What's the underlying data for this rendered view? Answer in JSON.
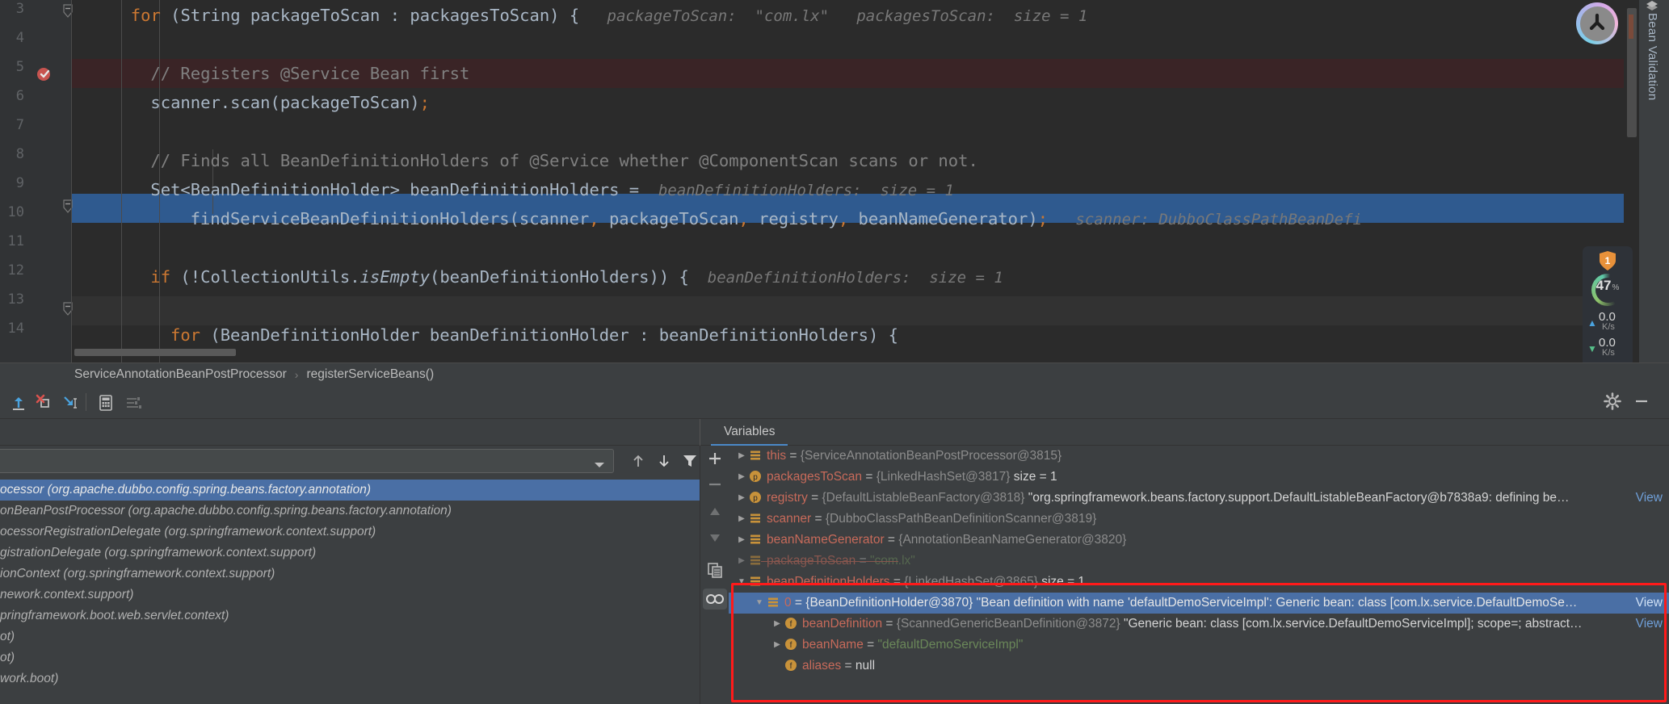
{
  "editor": {
    "lines": [
      {
        "no": "3",
        "indent": 6,
        "segs": [
          {
            "t": "for ",
            "c": "kw"
          },
          {
            "t": "(String packageToScan : packagesToScan) {",
            "c": "pl"
          },
          {
            "t": "   packageToScan:  \"com.lx\"   packagesToScan:  size = 1",
            "c": "hint"
          }
        ]
      },
      {
        "no": "4",
        "indent": 0,
        "segs": []
      },
      {
        "no": "5",
        "indent": 8,
        "segs": [
          {
            "t": "// Registers @Service Bean first",
            "c": "cm"
          }
        ]
      },
      {
        "no": "6",
        "indent": 8,
        "segs": [
          {
            "t": "scanner.scan(packageToScan)",
            "c": "pl"
          },
          {
            "t": ";",
            "c": "sep"
          }
        ]
      },
      {
        "no": "7",
        "indent": 0,
        "segs": []
      },
      {
        "no": "8",
        "indent": 8,
        "segs": [
          {
            "t": "// Finds all BeanDefinitionHolders of @Service whether @ComponentScan scans or not.",
            "c": "cm"
          }
        ]
      },
      {
        "no": "9",
        "indent": 8,
        "segs": [
          {
            "t": "Set<BeanDefinitionHolder> beanDefinitionHolders = ",
            "c": "pl"
          },
          {
            "t": " beanDefinitionHolders:  size = 1",
            "c": "hint"
          }
        ]
      },
      {
        "no": "10",
        "indent": 12,
        "segs": [
          {
            "t": "findServiceBeanDefinitionHolders(scanner",
            "c": "pl"
          },
          {
            "t": ", ",
            "c": "sep"
          },
          {
            "t": "packageToScan",
            "c": "pl"
          },
          {
            "t": ", ",
            "c": "sep"
          },
          {
            "t": "registry",
            "c": "pl"
          },
          {
            "t": ", ",
            "c": "sep"
          },
          {
            "t": "beanNameGenerator)",
            "c": "pl"
          },
          {
            "t": ";",
            "c": "sep"
          },
          {
            "t": "   scanner: DubboClassPathBeanDefi",
            "c": "hint"
          }
        ]
      },
      {
        "no": "11",
        "indent": 0,
        "segs": []
      },
      {
        "no": "12",
        "indent": 8,
        "segs": [
          {
            "t": "if ",
            "c": "kw"
          },
          {
            "t": "(!CollectionUtils.",
            "c": "pl"
          },
          {
            "t": "isEmpty",
            "c": "mi"
          },
          {
            "t": "(beanDefinitionHolders)) {",
            "c": "pl"
          },
          {
            "t": "  beanDefinitionHolders:  size = 1",
            "c": "hint"
          }
        ]
      },
      {
        "no": "13",
        "indent": 0,
        "segs": []
      },
      {
        "no": "14",
        "indent": 10,
        "segs": [
          {
            "t": "for ",
            "c": "kw"
          },
          {
            "t": "(BeanDefinitionHolder beanDefinitionHolder : beanDefinitionHolders) {",
            "c": "pl"
          }
        ]
      }
    ],
    "breadcrumb": {
      "class_name": "ServiceAnnotationBeanPostProcessor",
      "separator": "›",
      "method_name": "registerServiceBeans()"
    },
    "right_tab_label": "Bean Validation",
    "perf": {
      "inspection_count": "1",
      "memory_percent": "47",
      "percent_symbol": "%",
      "upload_value": "0.0",
      "upload_unit": "K/s",
      "download_value": "0.0",
      "download_unit": "K/s"
    }
  },
  "debug_toolbar": {
    "buttons": [
      {
        "name": "step-out-icon",
        "tooltip": "Step Out"
      },
      {
        "name": "force-step-into-icon",
        "tooltip": "Force Step Into"
      },
      {
        "name": "run-to-cursor-icon",
        "tooltip": "Run to Cursor"
      },
      {
        "name": "evaluate-expression-icon",
        "tooltip": "Evaluate Expression"
      },
      {
        "name": "settings-threads-icon",
        "tooltip": "Settings"
      }
    ],
    "gear_label": "Settings",
    "minimize_label": "Hide",
    "layout_label": "Layout Settings"
  },
  "variables_tab": {
    "label": "Variables"
  },
  "frames": {
    "search_value": "",
    "search_placeholder": "",
    "rows": [
      {
        "text": "ocessor (org.apache.dubbo.config.spring.beans.factory.annotation)",
        "selected": true
      },
      {
        "text": "onBeanPostProcessor (org.apache.dubbo.config.spring.beans.factory.annotation)",
        "selected": false
      },
      {
        "text": "ocessorRegistrationDelegate (org.springframework.context.support)",
        "selected": false
      },
      {
        "text": "gistrationDelegate (org.springframework.context.support)",
        "selected": false
      },
      {
        "text": "ionContext (org.springframework.context.support)",
        "selected": false
      },
      {
        "text": "nework.context.support)",
        "selected": false
      },
      {
        "text": "pringframework.boot.web.servlet.context)",
        "selected": false
      },
      {
        "text": "ot)",
        "selected": false
      },
      {
        "text": "ot)",
        "selected": false
      },
      {
        "text": "work.boot)",
        "selected": false
      }
    ]
  },
  "variables": {
    "side_buttons": [
      {
        "name": "add-watch-icon",
        "glyph": "+"
      },
      {
        "name": "remove-watch-icon",
        "glyph": "−"
      },
      {
        "name": "move-up-icon",
        "glyph": "▲"
      },
      {
        "name": "move-down-icon",
        "glyph": "▼"
      },
      {
        "name": "copy-value-icon",
        "glyph": ""
      },
      {
        "name": "watches-icon",
        "glyph": ""
      }
    ],
    "rows": [
      {
        "indent": 0,
        "arrow": "collapsed",
        "icon": "field",
        "name": "this",
        "eq": " = ",
        "type": "{ServiceAnnotationBeanPostProcessor@3815}",
        "value": "",
        "size": "",
        "view": "",
        "selected": false
      },
      {
        "indent": 0,
        "arrow": "collapsed",
        "icon": "param",
        "name": "packagesToScan",
        "eq": " = ",
        "type": "{LinkedHashSet@3817}",
        "value": "",
        "size": "  size = 1",
        "view": "",
        "selected": false
      },
      {
        "indent": 0,
        "arrow": "collapsed",
        "icon": "param",
        "name": "registry",
        "eq": " = ",
        "type": "{DefaultListableBeanFactory@3818}",
        "value": " \"org.springframework.beans.factory.support.DefaultListableBeanFactory@b7838a9: defining be…",
        "size": "",
        "view": "View",
        "selected": false
      },
      {
        "indent": 0,
        "arrow": "collapsed",
        "icon": "field",
        "name": "scanner",
        "eq": " = ",
        "type": "{DubboClassPathBeanDefinitionScanner@3819}",
        "value": "",
        "size": "",
        "view": "",
        "selected": false
      },
      {
        "indent": 0,
        "arrow": "collapsed",
        "icon": "field",
        "name": "beanNameGenerator",
        "eq": " = ",
        "type": "{AnnotationBeanNameGenerator@3820}",
        "value": "",
        "size": "",
        "view": "",
        "selected": false
      },
      {
        "indent": 0,
        "arrow": "collapsed",
        "icon": "field",
        "name": "packageToScan",
        "eq": " = ",
        "type": "",
        "value_str": "\"com.lx\"",
        "value": "",
        "size": "",
        "view": "",
        "selected": false,
        "clipped": true
      },
      {
        "indent": 0,
        "arrow": "expanded",
        "icon": "field",
        "name": "beanDefinitionHolders",
        "eq": " = ",
        "type": "{LinkedHashSet@3865}",
        "value": "",
        "size": "  size = 1",
        "view": "",
        "selected": false
      },
      {
        "indent": 1,
        "arrow": "expanded",
        "icon": "field",
        "name": "0",
        "eq": " = ",
        "type": "{BeanDefinitionHolder@3870}",
        "value": " \"Bean definition with name 'defaultDemoServiceImpl': Generic bean: class [com.lx.service.DefaultDemoSe…",
        "size": "",
        "view": "View",
        "selected": true
      },
      {
        "indent": 2,
        "arrow": "collapsed",
        "icon": "field-f",
        "name": "beanDefinition",
        "eq": " = ",
        "type": "{ScannedGenericBeanDefinition@3872}",
        "value": " \"Generic bean: class [com.lx.service.DefaultDemoServiceImpl]; scope=; abstract…",
        "size": "",
        "view": "View",
        "selected": false
      },
      {
        "indent": 2,
        "arrow": "collapsed",
        "icon": "field-f",
        "name": "beanName",
        "eq": " = ",
        "type": "",
        "value_str": "\"defaultDemoServiceImpl\"",
        "value": "",
        "size": "",
        "view": "",
        "selected": false
      },
      {
        "indent": 2,
        "arrow": "none",
        "icon": "field-f",
        "name": "aliases",
        "eq": " = ",
        "type": "",
        "value_plain": "null",
        "value": "",
        "size": "",
        "view": "",
        "selected": false
      }
    ]
  },
  "colors": {
    "editor_bg": "#2b2b2b",
    "panel_bg": "#3c3f41",
    "selection_blue": "#4a6fa5",
    "exec_line_blue": "#2f5a8f",
    "breakpoint_row": "#3a2426",
    "annotation_red": "#ff1a1a",
    "keyword_orange": "#cc7832",
    "string_green": "#6a8759",
    "var_name_red": "#c76a5a",
    "link_blue": "#6f9fd8"
  }
}
